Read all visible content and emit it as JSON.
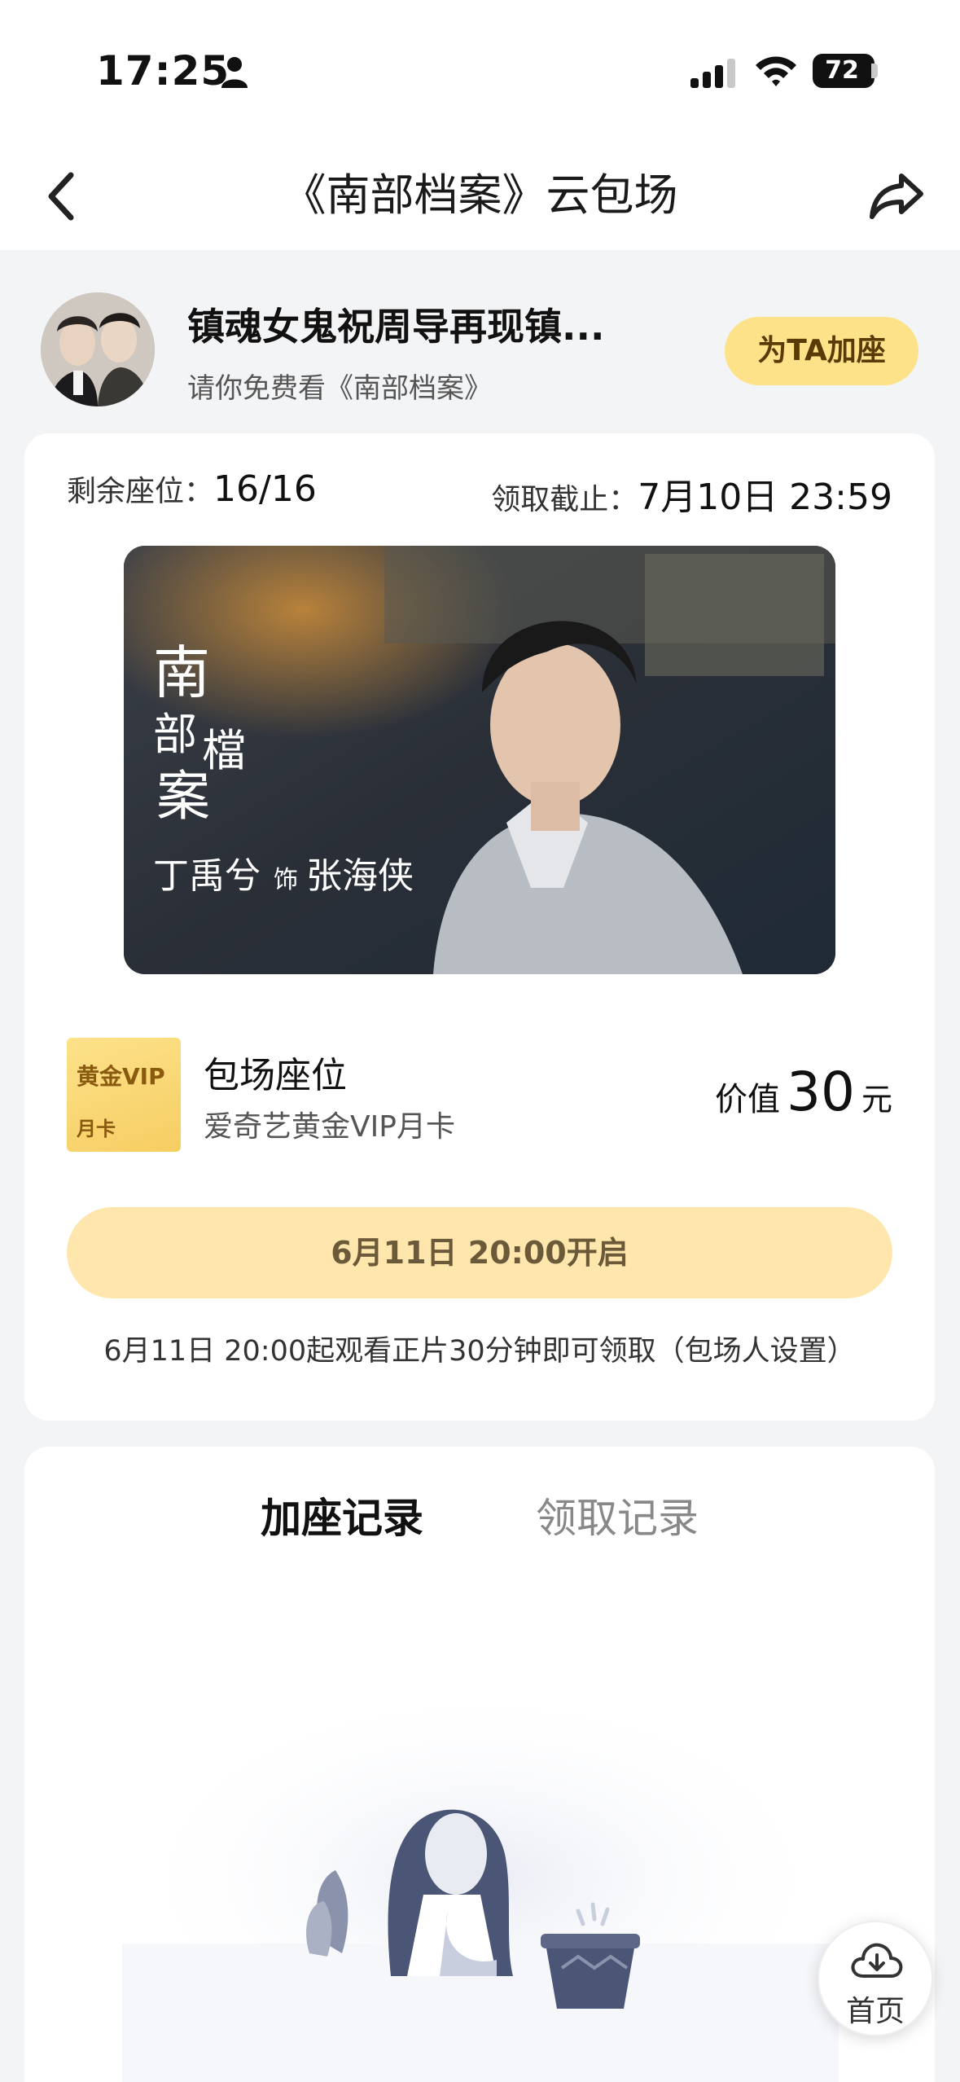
{
  "status_bar": {
    "time": "17:25",
    "battery": "72"
  },
  "nav": {
    "title": "《南部档案》云包场"
  },
  "host": {
    "title": "镇魂女鬼祝周导再现镇...",
    "subtitle": "请你免费看《南部档案》",
    "boost_button": "为TA加座"
  },
  "main": {
    "seats_label": "剩余座位：",
    "seats_value": "16/16",
    "deadline_label": "领取截止：",
    "deadline_value": "7月10日 23:59",
    "poster_title_lines": [
      "南",
      "部",
      "檔",
      "案"
    ],
    "poster_caption": "丁禹兮",
    "poster_caption_mid": "饰",
    "poster_caption_role": "张海侠",
    "package": {
      "icon_line1": "黄金VIP",
      "icon_line2": "月卡",
      "title": "包场座位",
      "subtitle": "爱奇艺黄金VIP月卡",
      "price_label": "价值",
      "price_value": "30",
      "price_unit": "元"
    },
    "open_button": "6月11日 20:00开启",
    "note": "6月11日 20:00起观看正片30分钟即可领取（包场人设置）"
  },
  "records": {
    "tabs": [
      "加座记录",
      "领取记录"
    ],
    "active_tab": "加座记录"
  },
  "home_fab": {
    "label": "首页",
    "icon": "cloud-home-icon"
  },
  "colors": {
    "accent": "#fde28a",
    "button_disabled": "#fee6ac",
    "page_bg": "#f3f4f6"
  }
}
